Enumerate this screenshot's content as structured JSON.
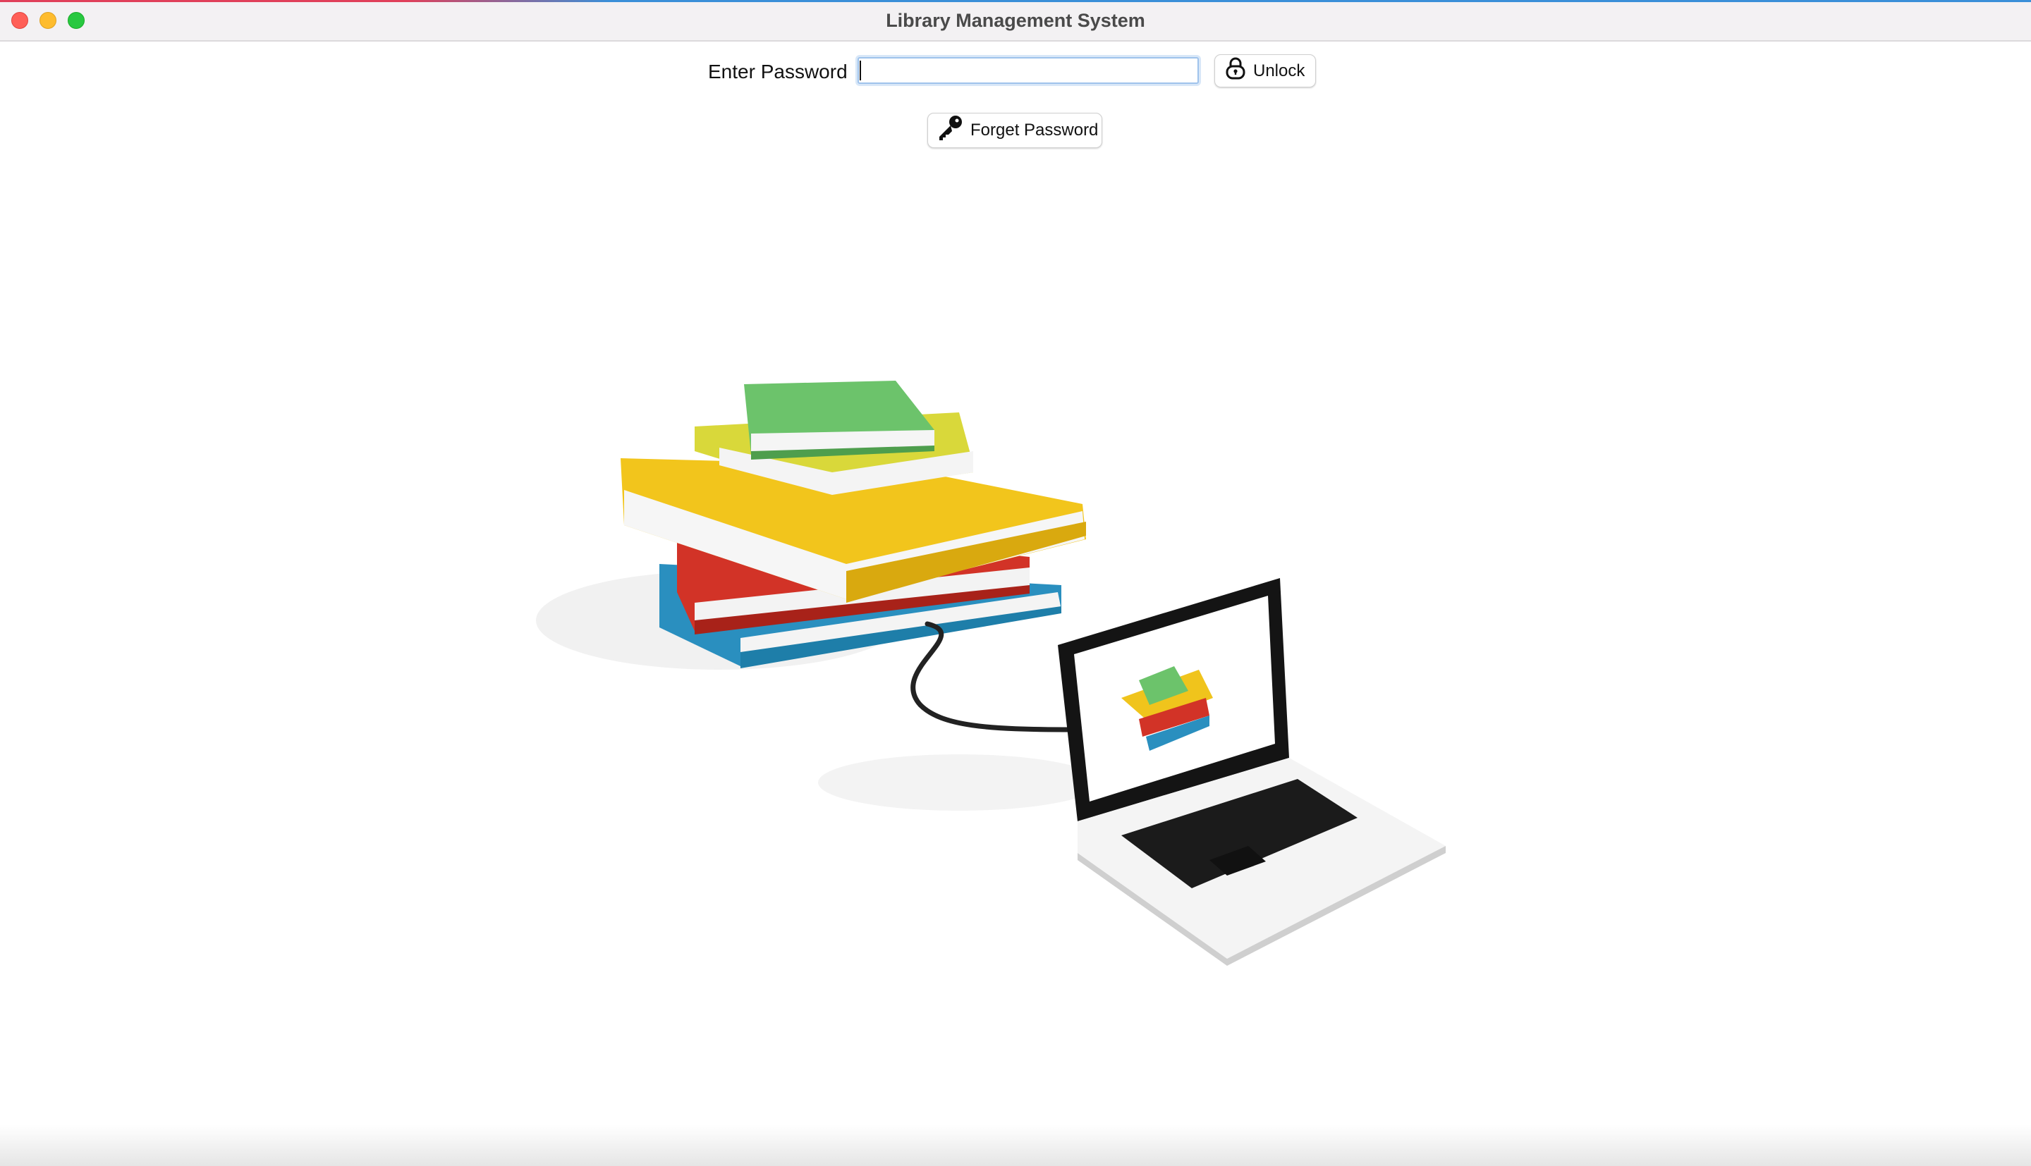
{
  "window": {
    "title": "Library Management System"
  },
  "login": {
    "password_label": "Enter Password",
    "password_value": "",
    "unlock_label": "Unlock",
    "unlock_icon": "padlock-icon",
    "forget_label": "Forget Password",
    "forget_icon": "key-icon"
  },
  "illustration": {
    "subject": "books-laptop-illustration",
    "icons": [
      "book-stack",
      "laptop"
    ]
  },
  "colors": {
    "close": "#ff5f57",
    "minimize": "#febc2e",
    "maximize": "#28c840",
    "focus_ring": "#9fc3ec"
  }
}
